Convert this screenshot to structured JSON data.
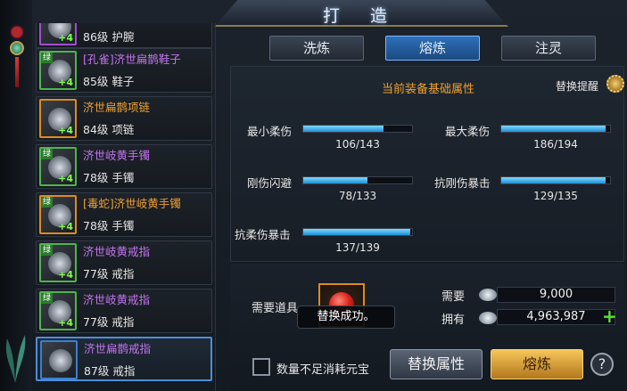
{
  "window": {
    "title": "打 造"
  },
  "tabs": [
    {
      "label": "洗炼",
      "active": false
    },
    {
      "label": "熔炼",
      "active": true
    },
    {
      "label": "注灵",
      "active": false
    }
  ],
  "items": [
    {
      "name": "",
      "level": "86级 护腕",
      "name_color": "#c474f0",
      "frame": "purple",
      "tag": "",
      "plus": "+4"
    },
    {
      "name": "[孔雀]济世扁鹊鞋子",
      "level": "85级 鞋子",
      "name_color": "#c474f0",
      "frame": "green",
      "tag": "绿",
      "plus": "+4"
    },
    {
      "name": "济世扁鹊项链",
      "level": "84级 项链",
      "name_color": "#f0a030",
      "frame": "orange",
      "tag": "",
      "plus": "+4"
    },
    {
      "name": "济世岐黄手镯",
      "level": "78级 手镯",
      "name_color": "#c474f0",
      "frame": "green",
      "tag": "绿",
      "plus": "+4"
    },
    {
      "name": "[毒蛇]济世岐黄手镯",
      "level": "78级 手镯",
      "name_color": "#f0a030",
      "frame": "orange",
      "tag": "绿",
      "plus": "+4"
    },
    {
      "name": "济世岐黄戒指",
      "level": "77级 戒指",
      "name_color": "#c474f0",
      "frame": "green",
      "tag": "绿",
      "plus": "+4"
    },
    {
      "name": "济世岐黄戒指",
      "level": "77级 戒指",
      "name_color": "#c474f0",
      "frame": "green",
      "tag": "绿",
      "plus": "+4"
    },
    {
      "name": "济世扁鹊戒指",
      "level": "87级 戒指",
      "name_color": "#c474f0",
      "frame": "blue",
      "tag": "",
      "plus": "",
      "selected": true
    }
  ],
  "panel": {
    "title": "当前装备基础属性",
    "swap_reminder": "替换提醒",
    "stats": [
      {
        "label": "最小柔伤",
        "current": 106,
        "max": 143,
        "text": "106/143"
      },
      {
        "label": "最大柔伤",
        "current": 186,
        "max": 194,
        "text": "186/194"
      },
      {
        "label": "刚伤闪避",
        "current": 78,
        "max": 133,
        "text": "78/133"
      },
      {
        "label": "抗刚伤暴击",
        "current": 129,
        "max": 135,
        "text": "129/135"
      },
      {
        "label": "抗柔伤暴击",
        "current": 137,
        "max": 139,
        "text": "137/139"
      }
    ]
  },
  "cost": {
    "need_item_label": "需要道具",
    "toast": "替换成功。",
    "need_label": "需要",
    "need_value": "9,000",
    "have_label": "拥有",
    "have_value": "4,963,987",
    "add_symbol": "+"
  },
  "footer": {
    "checkbox_label": "数量不足消耗元宝",
    "swap_button": "替换属性",
    "smelt_button": "熔炼",
    "help": "?"
  }
}
